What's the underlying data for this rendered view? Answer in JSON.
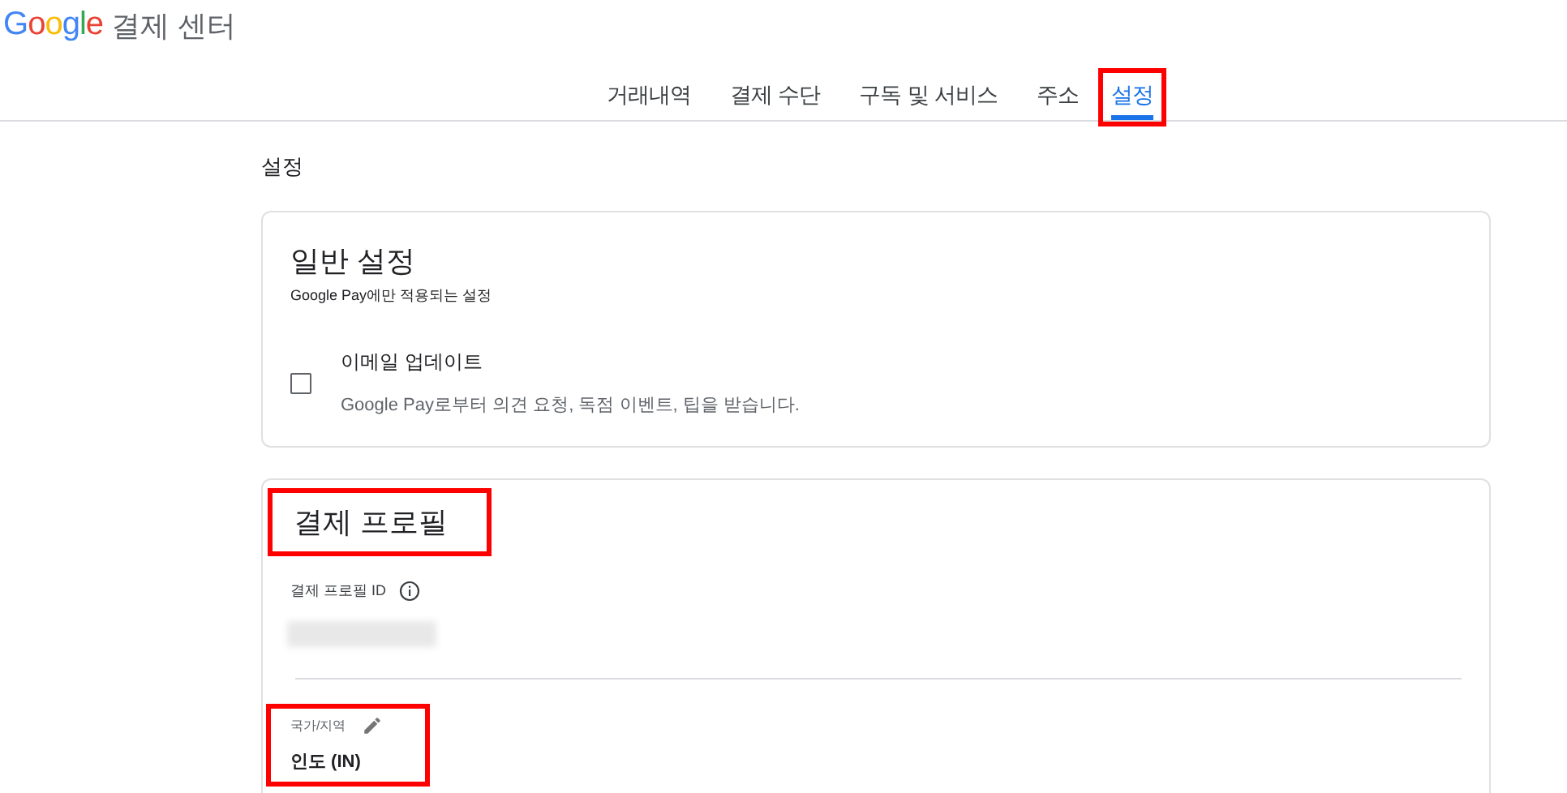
{
  "header": {
    "logo": "Google",
    "title": "결제 센터"
  },
  "tabs": [
    {
      "label": "거래내역",
      "selected": false,
      "highlighted": false
    },
    {
      "label": "결제 수단",
      "selected": false,
      "highlighted": false
    },
    {
      "label": "구독 및 서비스",
      "selected": false,
      "highlighted": false
    },
    {
      "label": "주소",
      "selected": false,
      "highlighted": false
    },
    {
      "label": "설정",
      "selected": true,
      "highlighted": true
    }
  ],
  "page_title": "설정",
  "general": {
    "title": "일반 설정",
    "subtitle": "Google Pay에만 적용되는 설정",
    "option": {
      "label": "이메일 업데이트",
      "description": "Google Pay로부터 의견 요청, 독점 이벤트, 팁을 받습니다.",
      "checked": false
    }
  },
  "profile": {
    "title": "결제 프로필",
    "title_highlighted": true,
    "id_label": "결제 프로필 ID",
    "country": {
      "label": "국가/지역",
      "value": "인도 (IN)",
      "highlighted": true
    }
  }
}
